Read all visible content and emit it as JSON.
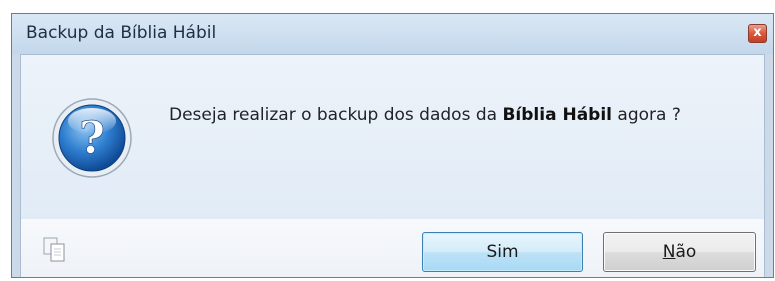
{
  "window": {
    "title": "Backup da Bíblia Hábil",
    "close_glyph": "x"
  },
  "message": {
    "prefix": "Deseja realizar o backup dos dados da ",
    "emphasis": "Bíblia Hábil",
    "suffix": " agora ?"
  },
  "icons": {
    "main": "question-icon",
    "footer": "copy-icon",
    "close": "close-icon"
  },
  "buttons": {
    "yes_label": "Sim",
    "no_mnemonic": "N",
    "no_rest": "ão"
  },
  "colors": {
    "dialog_bg": "#cbd9e8",
    "icon_blue": "#1f6fc4",
    "close_red": "#d9583e",
    "default_button_border": "#3c7fb1"
  }
}
